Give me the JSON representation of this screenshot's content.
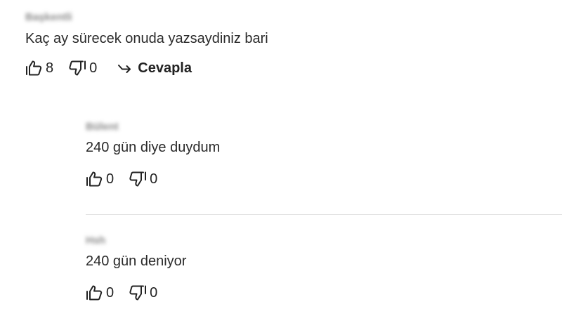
{
  "comments": [
    {
      "author": "Başkentli",
      "text": "Kaç ay sürecek onuda yazsaydiniz bari",
      "likes": "8",
      "dislikes": "0",
      "reply_label": "Cevapla"
    },
    {
      "author": "Bülent",
      "text": "240 gün diye duydum",
      "likes": "0",
      "dislikes": "0"
    },
    {
      "author": "Hsh",
      "text": "240 gün deniyor",
      "likes": "0",
      "dislikes": "0"
    }
  ],
  "icons": {
    "like": "thumbs-up-icon",
    "dislike": "thumbs-down-icon",
    "reply": "reply-arrow-icon"
  }
}
